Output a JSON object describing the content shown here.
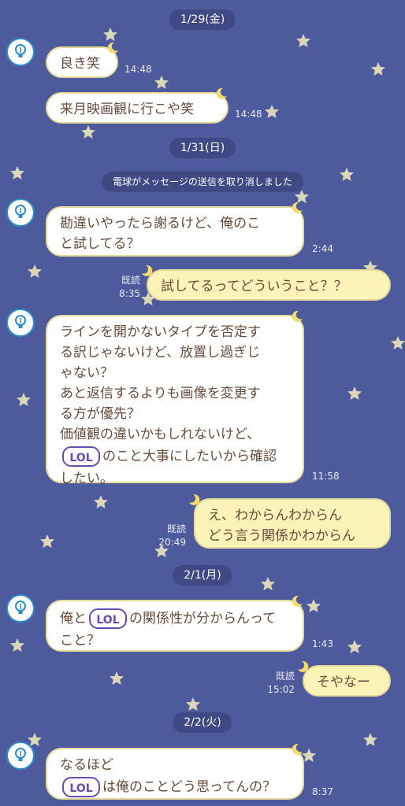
{
  "dates": [
    "1/29(金)",
    "1/31(日)",
    "2/1(月)",
    "2/2(火)"
  ],
  "system_notice": "電球がメッセージの送信を取り消しました",
  "messages": [
    {
      "side": "left",
      "lines": [
        "良き笑"
      ],
      "time": "14:48"
    },
    {
      "side": "left",
      "lines": [
        "来月映画観に行こや笑"
      ],
      "time": "14:48"
    },
    {
      "side": "left",
      "lines": [
        "勘違いやったら謝るけど、俺のこ",
        "と試してる？"
      ],
      "time": "2:44"
    },
    {
      "side": "right",
      "lines": [
        "試してるってどういうこと？？"
      ],
      "read": "既読",
      "time": "8:35"
    },
    {
      "side": "left",
      "lines": [
        "ラインを開かないタイプを否定す",
        "る訳じゃないけど、放置し過ぎじ",
        "ゃない？",
        "あと返信するよりも画像を変更す",
        "る方が優先？",
        "価値観の違いかもしれないけど、",
        "のこと大事にしたいから確認",
        "したい。"
      ],
      "time": "11:58"
    },
    {
      "side": "right",
      "lines": [
        "え、わからんわからん",
        "どう言う関係かわからん"
      ],
      "read": "既読",
      "time": "20:49"
    },
    {
      "side": "left",
      "lines": [
        "俺と",
        "の関係性が分からんって",
        "こと？"
      ],
      "time": "1:43"
    },
    {
      "side": "right",
      "lines": [
        "そやなー"
      ],
      "read": "既読",
      "time": "15:02"
    },
    {
      "side": "left",
      "lines": [
        "なるほど",
        "は俺のことどう思ってんの？"
      ],
      "time": "8:37"
    }
  ],
  "sticker_text": "LOL",
  "colors": {
    "background": "#4d5a9c",
    "left_bubble": "#ffffff",
    "right_bubble": "#fbf3b7",
    "text": "#6b4a3a"
  },
  "icons": {
    "avatar": "lightbulb-icon",
    "bubble_corner": "crescent-moon-icon",
    "background": "star-icon"
  }
}
